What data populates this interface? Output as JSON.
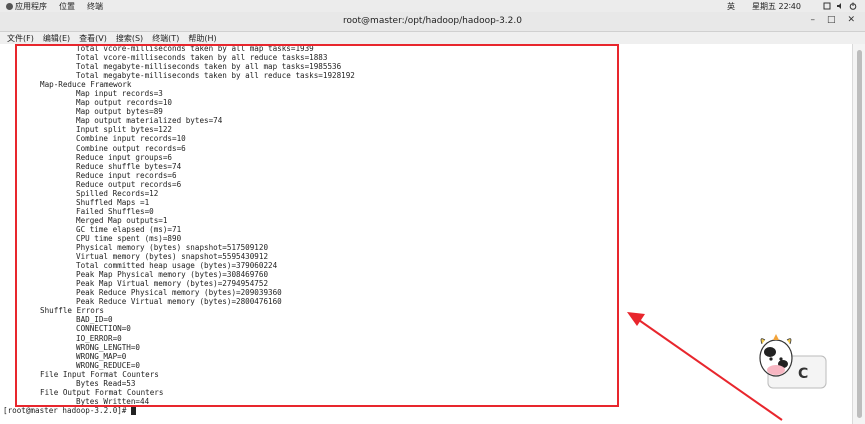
{
  "topbar": {
    "apps_label": "应用程序",
    "places_label": "位置",
    "terminal_label": "终端",
    "input_method": "英",
    "clock": "星期五 22∶40"
  },
  "window": {
    "title": "root@master:/opt/hadoop/hadoop-3.2.0"
  },
  "menu": [
    "文件(F)",
    "编辑(E)",
    "查看(V)",
    "搜索(S)",
    "终端(T)",
    "帮助(H)"
  ],
  "terminal": {
    "lines": [
      {
        "indent": 2,
        "text": "Total vcore-milliseconds taken by all map tasks=1939"
      },
      {
        "indent": 2,
        "text": "Total vcore-milliseconds taken by all reduce tasks=1883"
      },
      {
        "indent": 2,
        "text": "Total megabyte-milliseconds taken by all map tasks=1985536"
      },
      {
        "indent": 2,
        "text": "Total megabyte-milliseconds taken by all reduce tasks=1928192"
      },
      {
        "indent": 1,
        "text": "Map-Reduce Framework"
      },
      {
        "indent": 2,
        "text": "Map input records=3"
      },
      {
        "indent": 2,
        "text": "Map output records=10"
      },
      {
        "indent": 2,
        "text": "Map output bytes=89"
      },
      {
        "indent": 2,
        "text": "Map output materialized bytes=74"
      },
      {
        "indent": 2,
        "text": "Input split bytes=122"
      },
      {
        "indent": 2,
        "text": "Combine input records=10"
      },
      {
        "indent": 2,
        "text": "Combine output records=6"
      },
      {
        "indent": 2,
        "text": "Reduce input groups=6"
      },
      {
        "indent": 2,
        "text": "Reduce shuffle bytes=74"
      },
      {
        "indent": 2,
        "text": "Reduce input records=6"
      },
      {
        "indent": 2,
        "text": "Reduce output records=6"
      },
      {
        "indent": 2,
        "text": "Spilled Records=12"
      },
      {
        "indent": 2,
        "text": "Shuffled Maps =1"
      },
      {
        "indent": 2,
        "text": "Failed Shuffles=0"
      },
      {
        "indent": 2,
        "text": "Merged Map outputs=1"
      },
      {
        "indent": 2,
        "text": "GC time elapsed (ms)=71"
      },
      {
        "indent": 2,
        "text": "CPU time spent (ms)=890"
      },
      {
        "indent": 2,
        "text": "Physical memory (bytes) snapshot=517509120"
      },
      {
        "indent": 2,
        "text": "Virtual memory (bytes) snapshot=5595430912"
      },
      {
        "indent": 2,
        "text": "Total committed heap usage (bytes)=379060224"
      },
      {
        "indent": 2,
        "text": "Peak Map Physical memory (bytes)=308469760"
      },
      {
        "indent": 2,
        "text": "Peak Map Virtual memory (bytes)=2794954752"
      },
      {
        "indent": 2,
        "text": "Peak Reduce Physical memory (bytes)=209039360"
      },
      {
        "indent": 2,
        "text": "Peak Reduce Virtual memory (bytes)=2800476160"
      },
      {
        "indent": 1,
        "text": "Shuffle Errors"
      },
      {
        "indent": 2,
        "text": "BAD_ID=0"
      },
      {
        "indent": 2,
        "text": "CONNECTION=0"
      },
      {
        "indent": 2,
        "text": "IO_ERROR=0"
      },
      {
        "indent": 2,
        "text": "WRONG_LENGTH=0"
      },
      {
        "indent": 2,
        "text": "WRONG_MAP=0"
      },
      {
        "indent": 2,
        "text": "WRONG_REDUCE=0"
      },
      {
        "indent": 1,
        "text": "File Input Format Counters"
      },
      {
        "indent": 2,
        "text": "Bytes Read=53"
      },
      {
        "indent": 1,
        "text": "File Output Format Counters"
      },
      {
        "indent": 2,
        "text": "Bytes Written=44"
      }
    ],
    "prompt": "[root@master hadoop-3.2.0]# "
  },
  "colors": {
    "annotation": "#e8262d"
  },
  "icons": {
    "network": "network-icon",
    "volume": "volume-icon",
    "power": "power-icon",
    "mascot": "cow-mascot-icon"
  }
}
